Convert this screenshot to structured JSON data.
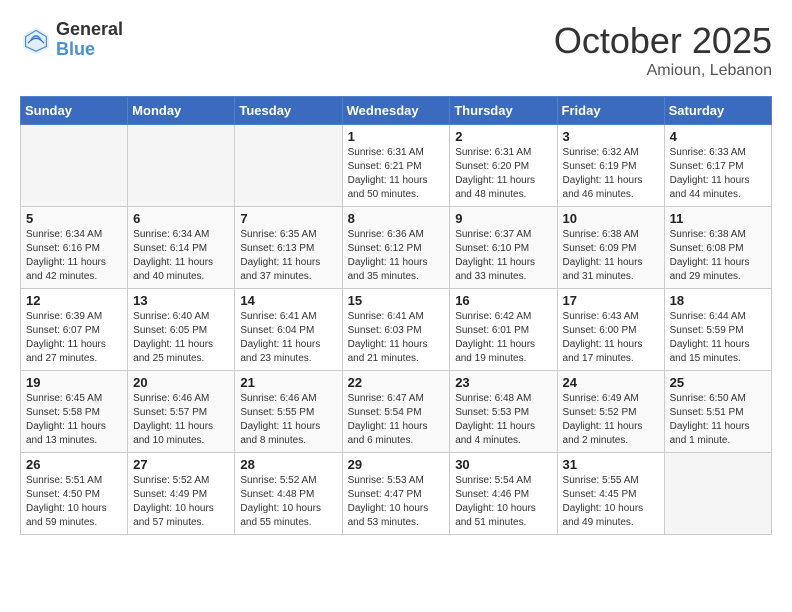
{
  "header": {
    "logo_general": "General",
    "logo_blue": "Blue",
    "month_title": "October 2025",
    "location": "Amioun, Lebanon"
  },
  "weekdays": [
    "Sunday",
    "Monday",
    "Tuesday",
    "Wednesday",
    "Thursday",
    "Friday",
    "Saturday"
  ],
  "weeks": [
    [
      {
        "day": "",
        "info": ""
      },
      {
        "day": "",
        "info": ""
      },
      {
        "day": "",
        "info": ""
      },
      {
        "day": "1",
        "info": "Sunrise: 6:31 AM\nSunset: 6:21 PM\nDaylight: 11 hours\nand 50 minutes."
      },
      {
        "day": "2",
        "info": "Sunrise: 6:31 AM\nSunset: 6:20 PM\nDaylight: 11 hours\nand 48 minutes."
      },
      {
        "day": "3",
        "info": "Sunrise: 6:32 AM\nSunset: 6:19 PM\nDaylight: 11 hours\nand 46 minutes."
      },
      {
        "day": "4",
        "info": "Sunrise: 6:33 AM\nSunset: 6:17 PM\nDaylight: 11 hours\nand 44 minutes."
      }
    ],
    [
      {
        "day": "5",
        "info": "Sunrise: 6:34 AM\nSunset: 6:16 PM\nDaylight: 11 hours\nand 42 minutes."
      },
      {
        "day": "6",
        "info": "Sunrise: 6:34 AM\nSunset: 6:14 PM\nDaylight: 11 hours\nand 40 minutes."
      },
      {
        "day": "7",
        "info": "Sunrise: 6:35 AM\nSunset: 6:13 PM\nDaylight: 11 hours\nand 37 minutes."
      },
      {
        "day": "8",
        "info": "Sunrise: 6:36 AM\nSunset: 6:12 PM\nDaylight: 11 hours\nand 35 minutes."
      },
      {
        "day": "9",
        "info": "Sunrise: 6:37 AM\nSunset: 6:10 PM\nDaylight: 11 hours\nand 33 minutes."
      },
      {
        "day": "10",
        "info": "Sunrise: 6:38 AM\nSunset: 6:09 PM\nDaylight: 11 hours\nand 31 minutes."
      },
      {
        "day": "11",
        "info": "Sunrise: 6:38 AM\nSunset: 6:08 PM\nDaylight: 11 hours\nand 29 minutes."
      }
    ],
    [
      {
        "day": "12",
        "info": "Sunrise: 6:39 AM\nSunset: 6:07 PM\nDaylight: 11 hours\nand 27 minutes."
      },
      {
        "day": "13",
        "info": "Sunrise: 6:40 AM\nSunset: 6:05 PM\nDaylight: 11 hours\nand 25 minutes."
      },
      {
        "day": "14",
        "info": "Sunrise: 6:41 AM\nSunset: 6:04 PM\nDaylight: 11 hours\nand 23 minutes."
      },
      {
        "day": "15",
        "info": "Sunrise: 6:41 AM\nSunset: 6:03 PM\nDaylight: 11 hours\nand 21 minutes."
      },
      {
        "day": "16",
        "info": "Sunrise: 6:42 AM\nSunset: 6:01 PM\nDaylight: 11 hours\nand 19 minutes."
      },
      {
        "day": "17",
        "info": "Sunrise: 6:43 AM\nSunset: 6:00 PM\nDaylight: 11 hours\nand 17 minutes."
      },
      {
        "day": "18",
        "info": "Sunrise: 6:44 AM\nSunset: 5:59 PM\nDaylight: 11 hours\nand 15 minutes."
      }
    ],
    [
      {
        "day": "19",
        "info": "Sunrise: 6:45 AM\nSunset: 5:58 PM\nDaylight: 11 hours\nand 13 minutes."
      },
      {
        "day": "20",
        "info": "Sunrise: 6:46 AM\nSunset: 5:57 PM\nDaylight: 11 hours\nand 10 minutes."
      },
      {
        "day": "21",
        "info": "Sunrise: 6:46 AM\nSunset: 5:55 PM\nDaylight: 11 hours\nand 8 minutes."
      },
      {
        "day": "22",
        "info": "Sunrise: 6:47 AM\nSunset: 5:54 PM\nDaylight: 11 hours\nand 6 minutes."
      },
      {
        "day": "23",
        "info": "Sunrise: 6:48 AM\nSunset: 5:53 PM\nDaylight: 11 hours\nand 4 minutes."
      },
      {
        "day": "24",
        "info": "Sunrise: 6:49 AM\nSunset: 5:52 PM\nDaylight: 11 hours\nand 2 minutes."
      },
      {
        "day": "25",
        "info": "Sunrise: 6:50 AM\nSunset: 5:51 PM\nDaylight: 11 hours\nand 1 minute."
      }
    ],
    [
      {
        "day": "26",
        "info": "Sunrise: 5:51 AM\nSunset: 4:50 PM\nDaylight: 10 hours\nand 59 minutes."
      },
      {
        "day": "27",
        "info": "Sunrise: 5:52 AM\nSunset: 4:49 PM\nDaylight: 10 hours\nand 57 minutes."
      },
      {
        "day": "28",
        "info": "Sunrise: 5:52 AM\nSunset: 4:48 PM\nDaylight: 10 hours\nand 55 minutes."
      },
      {
        "day": "29",
        "info": "Sunrise: 5:53 AM\nSunset: 4:47 PM\nDaylight: 10 hours\nand 53 minutes."
      },
      {
        "day": "30",
        "info": "Sunrise: 5:54 AM\nSunset: 4:46 PM\nDaylight: 10 hours\nand 51 minutes."
      },
      {
        "day": "31",
        "info": "Sunrise: 5:55 AM\nSunset: 4:45 PM\nDaylight: 10 hours\nand 49 minutes."
      },
      {
        "day": "",
        "info": ""
      }
    ]
  ]
}
